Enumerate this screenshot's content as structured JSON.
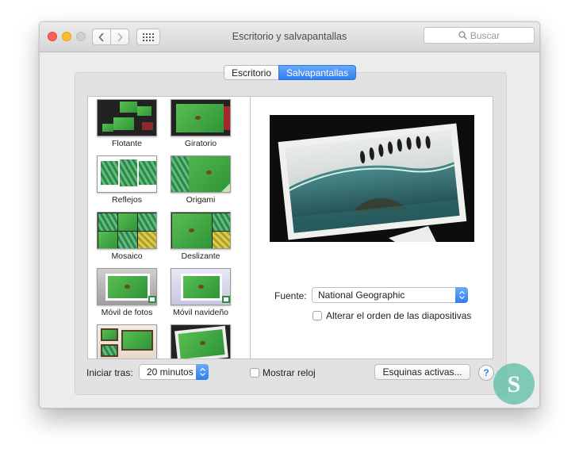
{
  "window": {
    "title": "Escritorio y salvapantallas"
  },
  "search": {
    "placeholder": "Buscar"
  },
  "tabs": [
    {
      "label": "Escritorio",
      "selected": false
    },
    {
      "label": "Salvapantallas",
      "selected": true
    }
  ],
  "screensavers": [
    {
      "label": "Flotante",
      "thumb": "flotante"
    },
    {
      "label": "Giratorio",
      "thumb": "giratorio"
    },
    {
      "label": "Reflejos",
      "thumb": "reflejos"
    },
    {
      "label": "Origami",
      "thumb": "origami"
    },
    {
      "label": "Mosaico",
      "thumb": "mosaico"
    },
    {
      "label": "Deslizante",
      "thumb": "deslizante"
    },
    {
      "label": "Móvil de fotos",
      "thumb": "movil-fotos"
    },
    {
      "label": "Móvil navideño",
      "thumb": "movil-navideno"
    },
    {
      "label": "",
      "thumb": "pared-fotos"
    },
    {
      "label": "",
      "thumb": "vintage"
    }
  ],
  "source": {
    "label": "Fuente:",
    "value": "National Geographic"
  },
  "shuffle": {
    "label": "Alterar el orden de las diapositivas",
    "checked": false
  },
  "start_after": {
    "label": "Iniciar tras:",
    "value": "20 minutos"
  },
  "show_clock": {
    "label": "Mostrar reloj",
    "checked": false
  },
  "hot_corners": {
    "label": "Esquinas activas..."
  },
  "help": {
    "label": "?"
  },
  "colors": {
    "accent": "#2f7ef2",
    "watermark": "#5bbfa5"
  }
}
